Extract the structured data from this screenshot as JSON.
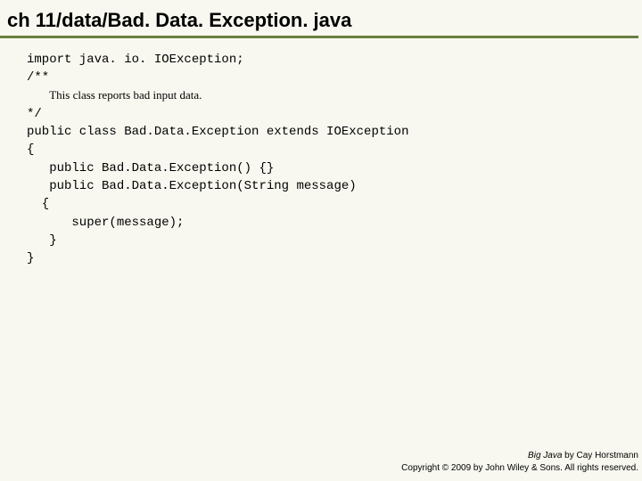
{
  "title": "ch 11/data/Bad. Data. Exception. java",
  "code": {
    "l1": "import java. io. IOException;",
    "l2": "",
    "l3": "/**",
    "l4_prefix": "   ",
    "l4_text": "This class reports bad input data.",
    "l5": "*/",
    "l6": "public class Bad.Data.Exception extends IOException",
    "l7": "{",
    "l8": "   public Bad.Data.Exception() {}",
    "l9": "   public Bad.Data.Exception(String message)",
    "l10": "  {",
    "l11": "      super(message);",
    "l12": "   }",
    "l13": "}"
  },
  "footer": {
    "book_title": "Big Java",
    "book_author": " by Cay Horstmann",
    "copyright": "Copyright © 2009 by John Wiley & Sons. All rights reserved."
  }
}
